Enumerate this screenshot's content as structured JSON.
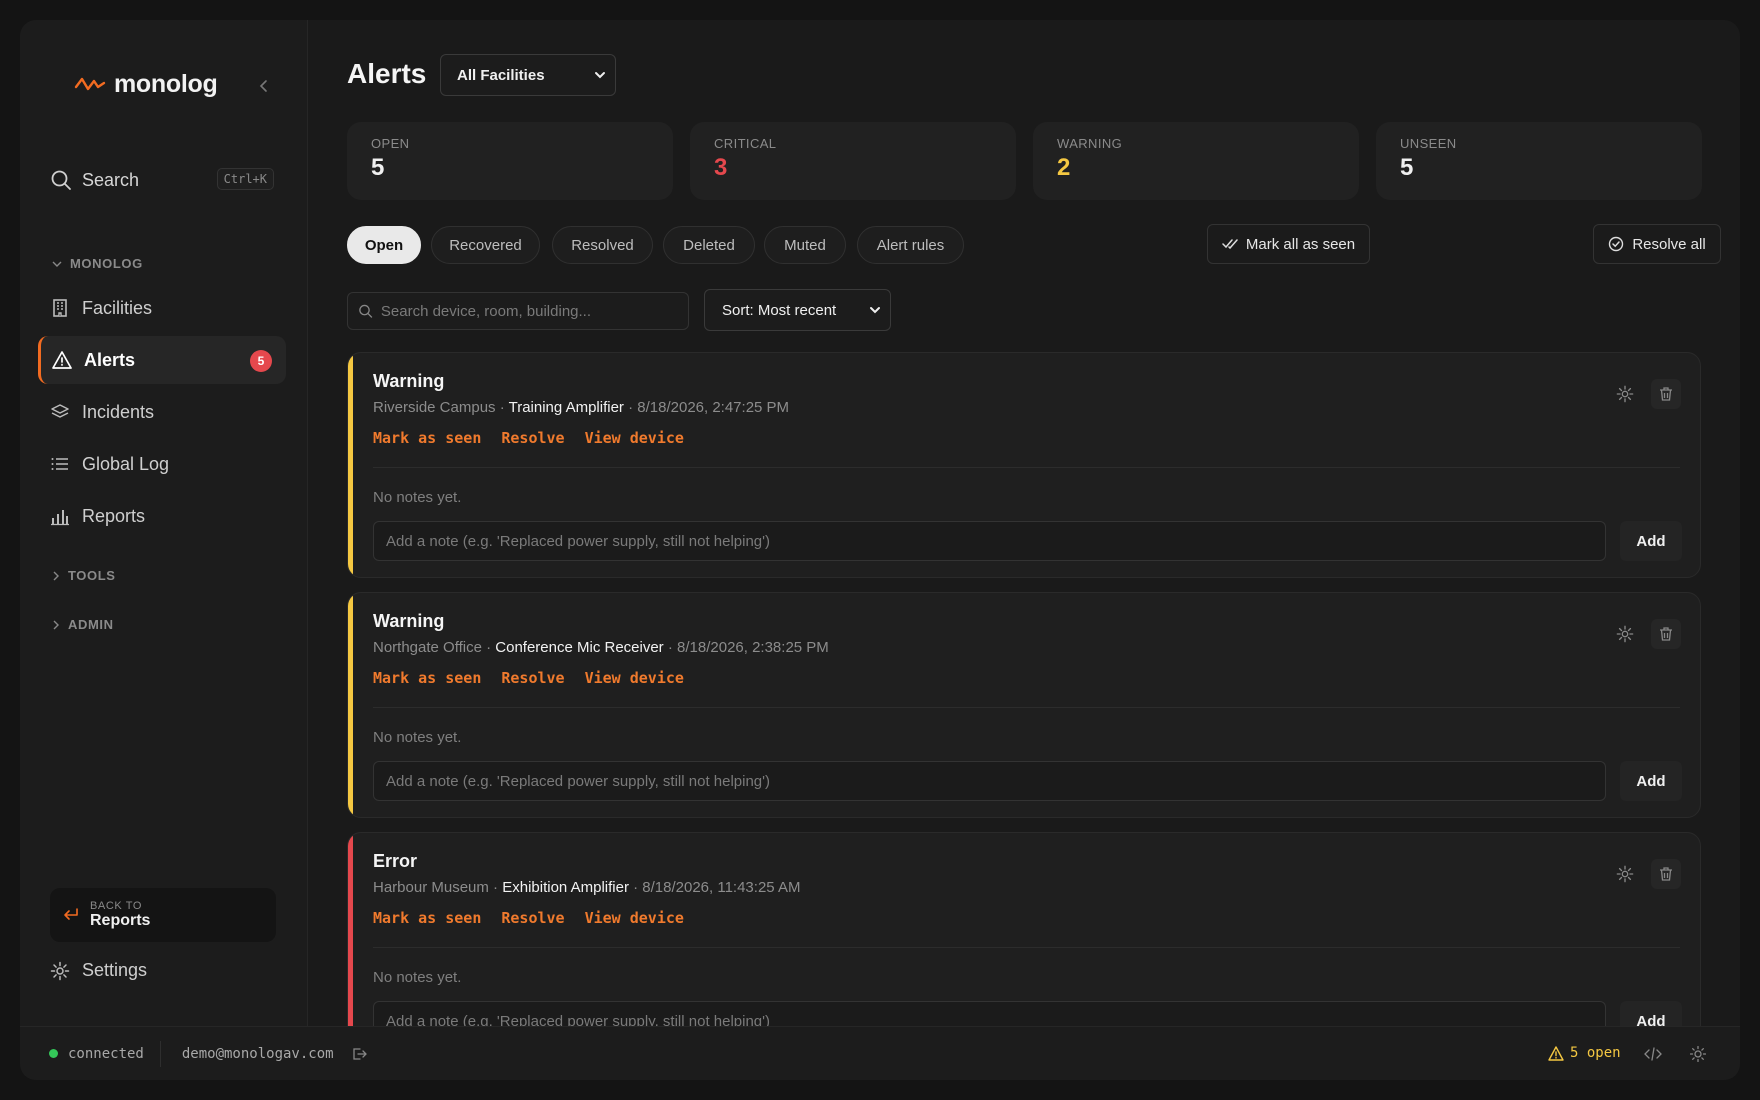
{
  "brand": {
    "name": "monolog",
    "accent": "#f26b21"
  },
  "sidebar": {
    "search_label": "Search",
    "search_shortcut": "Ctrl+K",
    "section_monolog": "MONOLOG",
    "items": [
      {
        "label": "Facilities",
        "icon": "building-icon"
      },
      {
        "label": "Alerts",
        "icon": "warning-icon",
        "badge": "5"
      },
      {
        "label": "Incidents",
        "icon": "layers-icon"
      },
      {
        "label": "Global Log",
        "icon": "list-icon"
      },
      {
        "label": "Reports",
        "icon": "bar-chart-icon"
      }
    ],
    "section_tools": "TOOLS",
    "section_admin": "ADMIN",
    "back_small": "BACK TO",
    "back_big": "Reports",
    "settings_label": "Settings"
  },
  "main": {
    "title": "Alerts",
    "facility_select": "All Facilities",
    "stats": [
      {
        "label": "OPEN",
        "value": "5",
        "color": "#f0f0f0"
      },
      {
        "label": "CRITICAL",
        "value": "3",
        "color": "#e5484d"
      },
      {
        "label": "WARNING",
        "value": "2",
        "color": "#f5c842"
      },
      {
        "label": "UNSEEN",
        "value": "5",
        "color": "#f0f0f0"
      }
    ],
    "tabs": [
      "Open",
      "Recovered",
      "Resolved",
      "Deleted",
      "Muted",
      "Alert rules"
    ],
    "active_tab": "Open",
    "mark_all_label": "Mark all as seen",
    "resolve_all_label": "Resolve all",
    "search_placeholder": "Search device, room, building...",
    "sort_label": "Sort: Most recent",
    "alerts": [
      {
        "severity": "Warning",
        "color": "#f5c842",
        "location": "Riverside Campus · ",
        "device": "Training Amplifier",
        "time": " · 8/18/2026, 2:47:25 PM"
      },
      {
        "severity": "Warning",
        "color": "#f5c842",
        "location": "Northgate Office · ",
        "device": "Conference Mic Receiver",
        "time": " · 8/18/2026, 2:38:25 PM"
      },
      {
        "severity": "Error",
        "color": "#e5484d",
        "location": "Harbour Museum · ",
        "device": "Exhibition Amplifier",
        "time": " · 8/18/2026, 11:43:25 AM"
      }
    ],
    "actions": {
      "mark_seen": "Mark as seen",
      "resolve": "Resolve",
      "view_device": "View device"
    },
    "no_notes": "No notes yet.",
    "note_placeholder": "Add a note (e.g. 'Replaced power supply, still not helping')",
    "add_label": "Add"
  },
  "statusbar": {
    "connection": "connected",
    "email": "demo@monologav.com",
    "open_count": "5 open",
    "open_color": "#f5c842"
  }
}
